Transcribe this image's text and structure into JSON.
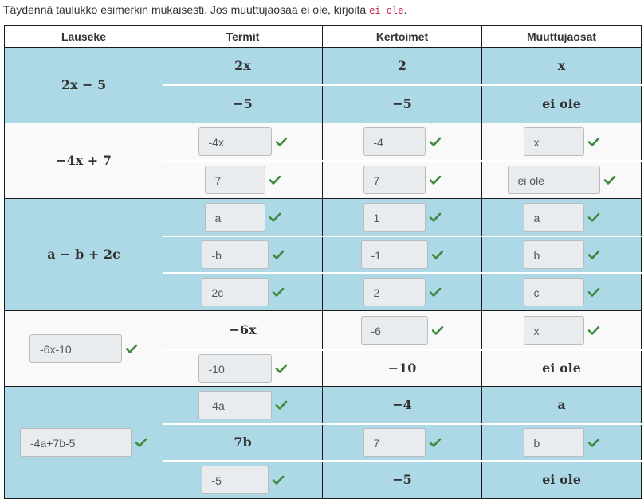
{
  "instruction": {
    "text": "Täydennä taulukko esimerkin mukaisesti. Jos muuttujaosaa ei ole, kirjoita",
    "code": "ei ole",
    "end": "."
  },
  "headers": [
    "Lauseke",
    "Termit",
    "Kertoimet",
    "Muuttujaosat"
  ],
  "groups": [
    {
      "expression": {
        "kind": "text",
        "value": "2x − 5"
      },
      "rows": [
        {
          "term": {
            "kind": "text",
            "value": "2x"
          },
          "coef": {
            "kind": "text",
            "value": "2"
          },
          "var": {
            "kind": "text",
            "value": "x"
          }
        },
        {
          "term": {
            "kind": "text",
            "value": "−5"
          },
          "coef": {
            "kind": "text",
            "value": "−5"
          },
          "var": {
            "kind": "text",
            "value": "ei ole"
          }
        }
      ]
    },
    {
      "expression": {
        "kind": "text",
        "value": "−4x + 7"
      },
      "rows": [
        {
          "term": {
            "kind": "input",
            "value": "-4x"
          },
          "coef": {
            "kind": "input",
            "value": "-4"
          },
          "var": {
            "kind": "input",
            "value": "x"
          }
        },
        {
          "term": {
            "kind": "input",
            "value": "7"
          },
          "coef": {
            "kind": "input",
            "value": "7"
          },
          "var": {
            "kind": "input",
            "value": "ei ole"
          }
        }
      ]
    },
    {
      "expression": {
        "kind": "text",
        "value": "a − b + 2c"
      },
      "rows": [
        {
          "term": {
            "kind": "input",
            "value": "a"
          },
          "coef": {
            "kind": "input",
            "value": "1"
          },
          "var": {
            "kind": "input",
            "value": "a"
          }
        },
        {
          "term": {
            "kind": "input",
            "value": "-b"
          },
          "coef": {
            "kind": "input",
            "value": "-1"
          },
          "var": {
            "kind": "input",
            "value": "b"
          }
        },
        {
          "term": {
            "kind": "input",
            "value": "2c"
          },
          "coef": {
            "kind": "input",
            "value": "2"
          },
          "var": {
            "kind": "input",
            "value": "c"
          }
        }
      ]
    },
    {
      "expression": {
        "kind": "input",
        "value": "-6x-10"
      },
      "rows": [
        {
          "term": {
            "kind": "text",
            "value": "−6x"
          },
          "coef": {
            "kind": "input",
            "value": "-6"
          },
          "var": {
            "kind": "input",
            "value": "x"
          }
        },
        {
          "term": {
            "kind": "input",
            "value": "-10"
          },
          "coef": {
            "kind": "text",
            "value": "−10"
          },
          "var": {
            "kind": "text",
            "value": "ei ole"
          }
        }
      ]
    },
    {
      "expression": {
        "kind": "input",
        "value": "-4a+7b-5"
      },
      "rows": [
        {
          "term": {
            "kind": "input",
            "value": "-4a"
          },
          "coef": {
            "kind": "text",
            "value": "−4"
          },
          "var": {
            "kind": "text",
            "value": "a"
          }
        },
        {
          "term": {
            "kind": "text",
            "value": "7b"
          },
          "coef": {
            "kind": "input",
            "value": "7"
          },
          "var": {
            "kind": "input",
            "value": "b"
          }
        },
        {
          "term": {
            "kind": "input",
            "value": "-5"
          },
          "coef": {
            "kind": "text",
            "value": "−5"
          },
          "var": {
            "kind": "text",
            "value": "ei ole"
          }
        }
      ]
    }
  ],
  "colors": {
    "blue_row": "#add8e6",
    "white_row": "#f9f9f9",
    "check": "#3c8a3c",
    "input_bg": "#e9ecef"
  },
  "icons": {
    "correct": "check-icon"
  }
}
